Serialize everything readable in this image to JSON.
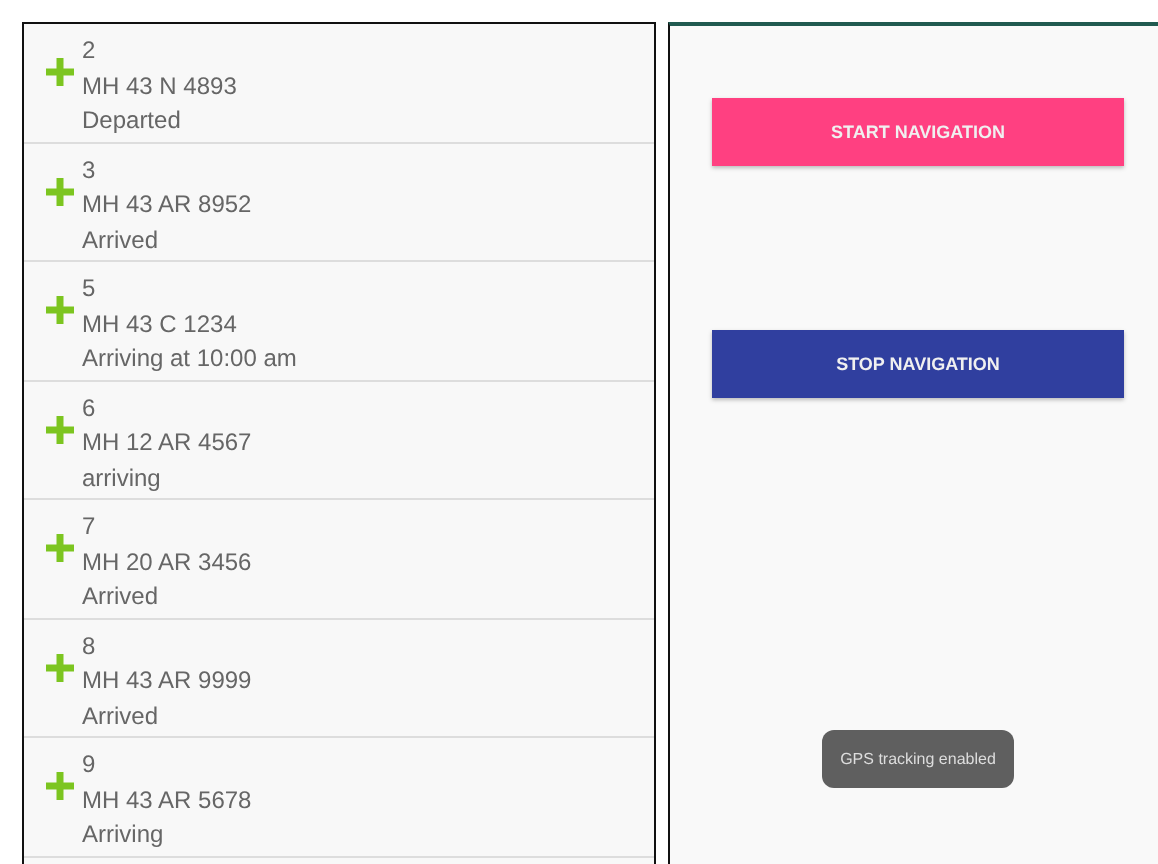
{
  "vehicles": [
    {
      "number": "2",
      "plate": "MH 43 N 4893",
      "status": "Departed"
    },
    {
      "number": "3",
      "plate": "MH 43 AR 8952",
      "status": "Arrived"
    },
    {
      "number": "5",
      "plate": "MH 43 C 1234",
      "status": "Arriving at 10:00 am"
    },
    {
      "number": "6",
      "plate": "MH 12 AR 4567",
      "status": "arriving"
    },
    {
      "number": "7",
      "plate": "MH 20 AR 3456",
      "status": "Arrived"
    },
    {
      "number": "8",
      "plate": "MH 43 AR 9999",
      "status": "Arrived"
    },
    {
      "number": "9",
      "plate": "MH 43 AR 5678",
      "status": "Arriving"
    }
  ],
  "buttons": [
    {
      "label": "START NAVIGATION",
      "kind": "start"
    },
    {
      "label": "STOP NAVIGATION",
      "kind": "stop"
    }
  ],
  "toast": "GPS tracking enabled"
}
